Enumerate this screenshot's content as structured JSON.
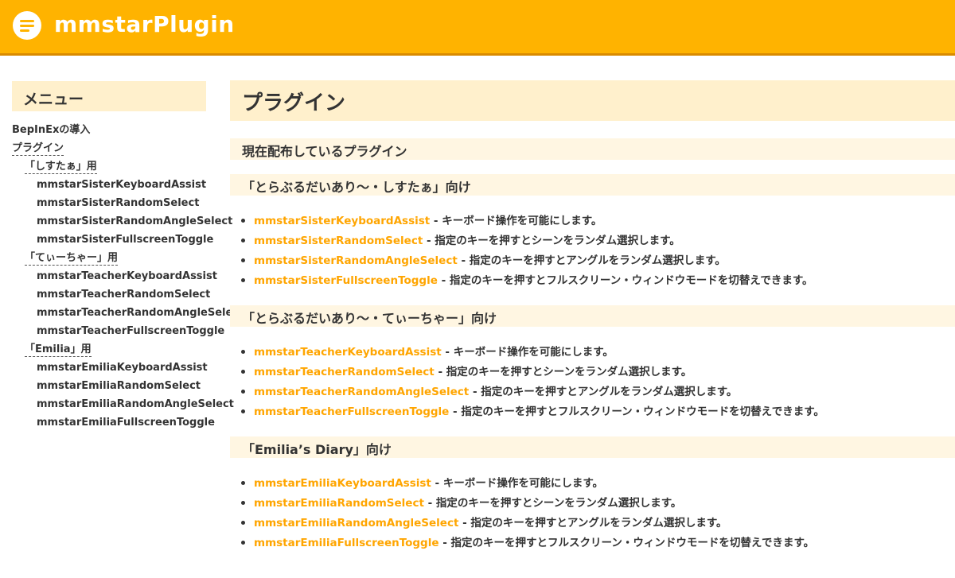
{
  "header": {
    "title": "mmstarPlugin"
  },
  "sidebar": {
    "heading": "メニュー",
    "items": [
      {
        "label": "BepInExの導入",
        "level": 1,
        "dashed": false
      },
      {
        "label": "プラグイン",
        "level": 1,
        "dashed": true
      },
      {
        "label": "「しすたぁ」用",
        "level": 2,
        "dashed": true
      },
      {
        "label": "mmstarSisterKeyboardAssist",
        "level": 3,
        "dashed": false
      },
      {
        "label": "mmstarSisterRandomSelect",
        "level": 3,
        "dashed": false
      },
      {
        "label": "mmstarSisterRandomAngleSelect",
        "level": 3,
        "dashed": false
      },
      {
        "label": "mmstarSisterFullscreenToggle",
        "level": 3,
        "dashed": false
      },
      {
        "label": "「てぃーちゃー」用",
        "level": 2,
        "dashed": true
      },
      {
        "label": "mmstarTeacherKeyboardAssist",
        "level": 3,
        "dashed": false
      },
      {
        "label": "mmstarTeacherRandomSelect",
        "level": 3,
        "dashed": false
      },
      {
        "label": "mmstarTeacherRandomAngleSelect",
        "level": 3,
        "dashed": false
      },
      {
        "label": "mmstarTeacherFullscreenToggle",
        "level": 3,
        "dashed": false
      },
      {
        "label": "「Emilia」用",
        "level": 2,
        "dashed": true
      },
      {
        "label": "mmstarEmiliaKeyboardAssist",
        "level": 3,
        "dashed": false
      },
      {
        "label": "mmstarEmiliaRandomSelect",
        "level": 3,
        "dashed": false
      },
      {
        "label": "mmstarEmiliaRandomAngleSelect",
        "level": 3,
        "dashed": false
      },
      {
        "label": "mmstarEmiliaFullscreenToggle",
        "level": 3,
        "dashed": false
      }
    ]
  },
  "main": {
    "title": "プラグイン",
    "intro_heading": "現在配布しているプラグイン",
    "sections": [
      {
        "heading": "「とらぶるだいあり〜・しすたぁ」向け",
        "plugins": [
          {
            "name": "mmstarSisterKeyboardAssist",
            "desc": " - キーボード操作を可能にします。"
          },
          {
            "name": "mmstarSisterRandomSelect",
            "desc": " - 指定のキーを押すとシーンをランダム選択します。"
          },
          {
            "name": "mmstarSisterRandomAngleSelect",
            "desc": " - 指定のキーを押すとアングルをランダム選択します。"
          },
          {
            "name": "mmstarSisterFullscreenToggle",
            "desc": " - 指定のキーを押すとフルスクリーン・ウィンドウモードを切替えできます。"
          }
        ]
      },
      {
        "heading": "「とらぶるだいあり〜・てぃーちゃー」向け",
        "plugins": [
          {
            "name": "mmstarTeacherKeyboardAssist",
            "desc": " - キーボード操作を可能にします。"
          },
          {
            "name": "mmstarTeacherRandomSelect",
            "desc": " - 指定のキーを押すとシーンをランダム選択します。"
          },
          {
            "name": "mmstarTeacherRandomAngleSelect",
            "desc": " - 指定のキーを押すとアングルをランダム選択します。"
          },
          {
            "name": "mmstarTeacherFullscreenToggle",
            "desc": " - 指定のキーを押すとフルスクリーン・ウィンドウモードを切替えできます。"
          }
        ]
      },
      {
        "heading": "「Emilia’s Diary」向け",
        "plugins": [
          {
            "name": "mmstarEmiliaKeyboardAssist",
            "desc": " - キーボード操作を可能にします。"
          },
          {
            "name": "mmstarEmiliaRandomSelect",
            "desc": " - 指定のキーを押すとシーンをランダム選択します。"
          },
          {
            "name": "mmstarEmiliaRandomAngleSelect",
            "desc": " - 指定のキーを押すとアングルをランダム選択します。"
          },
          {
            "name": "mmstarEmiliaFullscreenToggle",
            "desc": " - 指定のキーを押すとフルスクリーン・ウィンドウモードを切替えできます。"
          }
        ]
      }
    ]
  },
  "colors": {
    "header_bg": "#ffb300",
    "header_border": "#d98a00",
    "heading_bg": "#fff0cc",
    "subheading_bg": "#fff6e2",
    "link": "#ffa500",
    "text": "#333333"
  },
  "icons": {
    "logo": "menu-lines-icon"
  }
}
